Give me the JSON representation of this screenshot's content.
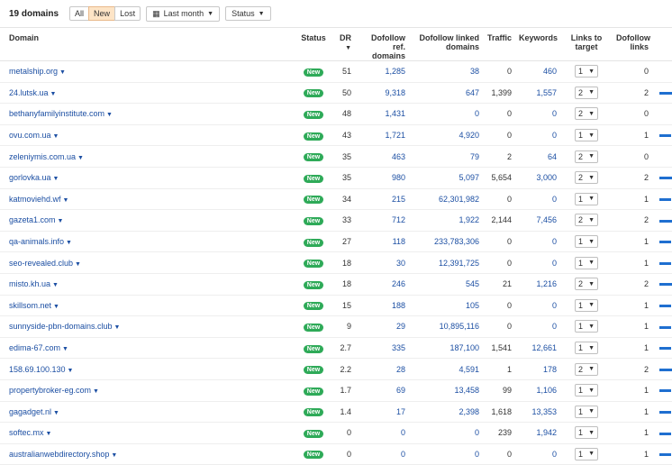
{
  "header": {
    "count": "19 domains",
    "filters": [
      "All",
      "New",
      "Lost"
    ],
    "active_filter": "New",
    "date_dropdown": "Last month",
    "status_dropdown": "Status"
  },
  "columns": [
    "Domain",
    "Status",
    "DR",
    "Dofollow ref. domains",
    "Dofollow linked domains",
    "Traffic",
    "Keywords",
    "Links to target",
    "Dofollow links"
  ],
  "rows": [
    {
      "domain": "metalship.org",
      "status": "New",
      "dr": "51",
      "ref": "1,285",
      "linked": "38",
      "traffic": "0",
      "keywords": "460",
      "links": "1",
      "dofollow": "0",
      "bar": 0
    },
    {
      "domain": "24.lutsk.ua",
      "status": "New",
      "dr": "50",
      "ref": "9,318",
      "linked": "647",
      "traffic": "1,399",
      "keywords": "1,557",
      "links": "2",
      "dofollow": "2",
      "bar": 2
    },
    {
      "domain": "bethanyfamilyinstitute.com",
      "status": "New",
      "dr": "48",
      "ref": "1,431",
      "linked": "0",
      "traffic": "0",
      "keywords": "0",
      "links": "2",
      "dofollow": "0",
      "bar": 0
    },
    {
      "domain": "ovu.com.ua",
      "status": "New",
      "dr": "43",
      "ref": "1,721",
      "linked": "4,920",
      "traffic": "0",
      "keywords": "0",
      "links": "1",
      "dofollow": "1",
      "bar": 1
    },
    {
      "domain": "zeleniymis.com.ua",
      "status": "New",
      "dr": "35",
      "ref": "463",
      "linked": "79",
      "traffic": "2",
      "keywords": "64",
      "links": "2",
      "dofollow": "0",
      "bar": 0
    },
    {
      "domain": "gorlovka.ua",
      "status": "New",
      "dr": "35",
      "ref": "980",
      "linked": "5,097",
      "traffic": "5,654",
      "keywords": "3,000",
      "links": "2",
      "dofollow": "2",
      "bar": 2
    },
    {
      "domain": "katmoviehd.wf",
      "status": "New",
      "dr": "34",
      "ref": "215",
      "linked": "62,301,982",
      "traffic": "0",
      "keywords": "0",
      "links": "1",
      "dofollow": "1",
      "bar": 1
    },
    {
      "domain": "gazeta1.com",
      "status": "New",
      "dr": "33",
      "ref": "712",
      "linked": "1,922",
      "traffic": "2,144",
      "keywords": "7,456",
      "links": "2",
      "dofollow": "2",
      "bar": 2
    },
    {
      "domain": "qa-animals.info",
      "status": "New",
      "dr": "27",
      "ref": "118",
      "linked": "233,783,306",
      "traffic": "0",
      "keywords": "0",
      "links": "1",
      "dofollow": "1",
      "bar": 1
    },
    {
      "domain": "seo-revealed.club",
      "status": "New",
      "dr": "18",
      "ref": "30",
      "linked": "12,391,725",
      "traffic": "0",
      "keywords": "0",
      "links": "1",
      "dofollow": "1",
      "bar": 1
    },
    {
      "domain": "misto.kh.ua",
      "status": "New",
      "dr": "18",
      "ref": "246",
      "linked": "545",
      "traffic": "21",
      "keywords": "1,216",
      "links": "2",
      "dofollow": "2",
      "bar": 2
    },
    {
      "domain": "skillsom.net",
      "status": "New",
      "dr": "15",
      "ref": "188",
      "linked": "105",
      "traffic": "0",
      "keywords": "0",
      "links": "1",
      "dofollow": "1",
      "bar": 1
    },
    {
      "domain": "sunnyside-pbn-domains.club",
      "status": "New",
      "dr": "9",
      "ref": "29",
      "linked": "10,895,116",
      "traffic": "0",
      "keywords": "0",
      "links": "1",
      "dofollow": "1",
      "bar": 1
    },
    {
      "domain": "edima-67.com",
      "status": "New",
      "dr": "2.7",
      "ref": "335",
      "linked": "187,100",
      "traffic": "1,541",
      "keywords": "12,661",
      "links": "1",
      "dofollow": "1",
      "bar": 1
    },
    {
      "domain": "158.69.100.130",
      "status": "New",
      "dr": "2.2",
      "ref": "28",
      "linked": "4,591",
      "traffic": "1",
      "keywords": "178",
      "links": "2",
      "dofollow": "2",
      "bar": 2
    },
    {
      "domain": "propertybroker-eg.com",
      "status": "New",
      "dr": "1.7",
      "ref": "69",
      "linked": "13,458",
      "traffic": "99",
      "keywords": "1,106",
      "links": "1",
      "dofollow": "1",
      "bar": 1
    },
    {
      "domain": "gagadget.nl",
      "status": "New",
      "dr": "1.4",
      "ref": "17",
      "linked": "2,398",
      "traffic": "1,618",
      "keywords": "13,353",
      "links": "1",
      "dofollow": "1",
      "bar": 1
    },
    {
      "domain": "softec.mx",
      "status": "New",
      "dr": "0",
      "ref": "0",
      "linked": "0",
      "traffic": "239",
      "keywords": "1,942",
      "links": "1",
      "dofollow": "1",
      "bar": 1
    },
    {
      "domain": "australianwebdirectory.shop",
      "status": "New",
      "dr": "0",
      "ref": "0",
      "linked": "0",
      "traffic": "0",
      "keywords": "0",
      "links": "1",
      "dofollow": "1",
      "bar": 1
    }
  ]
}
